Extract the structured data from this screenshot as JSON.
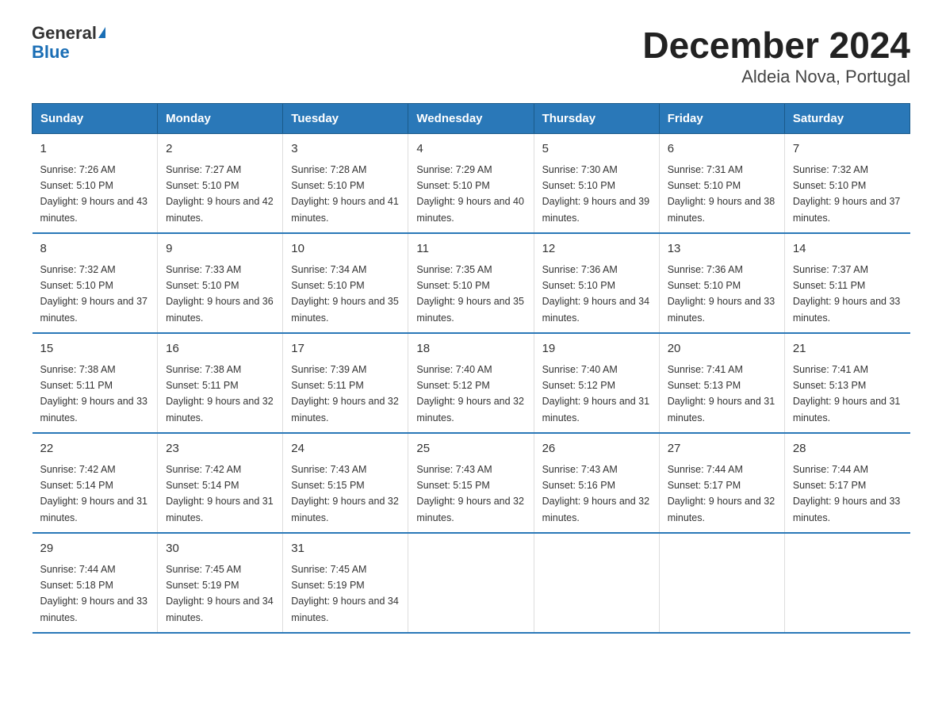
{
  "header": {
    "logo_general": "General",
    "logo_blue": "Blue",
    "title": "December 2024",
    "subtitle": "Aldeia Nova, Portugal"
  },
  "days_of_week": [
    "Sunday",
    "Monday",
    "Tuesday",
    "Wednesday",
    "Thursday",
    "Friday",
    "Saturday"
  ],
  "weeks": [
    [
      {
        "num": "1",
        "sunrise": "7:26 AM",
        "sunset": "5:10 PM",
        "daylight": "9 hours and 43 minutes."
      },
      {
        "num": "2",
        "sunrise": "7:27 AM",
        "sunset": "5:10 PM",
        "daylight": "9 hours and 42 minutes."
      },
      {
        "num": "3",
        "sunrise": "7:28 AM",
        "sunset": "5:10 PM",
        "daylight": "9 hours and 41 minutes."
      },
      {
        "num": "4",
        "sunrise": "7:29 AM",
        "sunset": "5:10 PM",
        "daylight": "9 hours and 40 minutes."
      },
      {
        "num": "5",
        "sunrise": "7:30 AM",
        "sunset": "5:10 PM",
        "daylight": "9 hours and 39 minutes."
      },
      {
        "num": "6",
        "sunrise": "7:31 AM",
        "sunset": "5:10 PM",
        "daylight": "9 hours and 38 minutes."
      },
      {
        "num": "7",
        "sunrise": "7:32 AM",
        "sunset": "5:10 PM",
        "daylight": "9 hours and 37 minutes."
      }
    ],
    [
      {
        "num": "8",
        "sunrise": "7:32 AM",
        "sunset": "5:10 PM",
        "daylight": "9 hours and 37 minutes."
      },
      {
        "num": "9",
        "sunrise": "7:33 AM",
        "sunset": "5:10 PM",
        "daylight": "9 hours and 36 minutes."
      },
      {
        "num": "10",
        "sunrise": "7:34 AM",
        "sunset": "5:10 PM",
        "daylight": "9 hours and 35 minutes."
      },
      {
        "num": "11",
        "sunrise": "7:35 AM",
        "sunset": "5:10 PM",
        "daylight": "9 hours and 35 minutes."
      },
      {
        "num": "12",
        "sunrise": "7:36 AM",
        "sunset": "5:10 PM",
        "daylight": "9 hours and 34 minutes."
      },
      {
        "num": "13",
        "sunrise": "7:36 AM",
        "sunset": "5:10 PM",
        "daylight": "9 hours and 33 minutes."
      },
      {
        "num": "14",
        "sunrise": "7:37 AM",
        "sunset": "5:11 PM",
        "daylight": "9 hours and 33 minutes."
      }
    ],
    [
      {
        "num": "15",
        "sunrise": "7:38 AM",
        "sunset": "5:11 PM",
        "daylight": "9 hours and 33 minutes."
      },
      {
        "num": "16",
        "sunrise": "7:38 AM",
        "sunset": "5:11 PM",
        "daylight": "9 hours and 32 minutes."
      },
      {
        "num": "17",
        "sunrise": "7:39 AM",
        "sunset": "5:11 PM",
        "daylight": "9 hours and 32 minutes."
      },
      {
        "num": "18",
        "sunrise": "7:40 AM",
        "sunset": "5:12 PM",
        "daylight": "9 hours and 32 minutes."
      },
      {
        "num": "19",
        "sunrise": "7:40 AM",
        "sunset": "5:12 PM",
        "daylight": "9 hours and 31 minutes."
      },
      {
        "num": "20",
        "sunrise": "7:41 AM",
        "sunset": "5:13 PM",
        "daylight": "9 hours and 31 minutes."
      },
      {
        "num": "21",
        "sunrise": "7:41 AM",
        "sunset": "5:13 PM",
        "daylight": "9 hours and 31 minutes."
      }
    ],
    [
      {
        "num": "22",
        "sunrise": "7:42 AM",
        "sunset": "5:14 PM",
        "daylight": "9 hours and 31 minutes."
      },
      {
        "num": "23",
        "sunrise": "7:42 AM",
        "sunset": "5:14 PM",
        "daylight": "9 hours and 31 minutes."
      },
      {
        "num": "24",
        "sunrise": "7:43 AM",
        "sunset": "5:15 PM",
        "daylight": "9 hours and 32 minutes."
      },
      {
        "num": "25",
        "sunrise": "7:43 AM",
        "sunset": "5:15 PM",
        "daylight": "9 hours and 32 minutes."
      },
      {
        "num": "26",
        "sunrise": "7:43 AM",
        "sunset": "5:16 PM",
        "daylight": "9 hours and 32 minutes."
      },
      {
        "num": "27",
        "sunrise": "7:44 AM",
        "sunset": "5:17 PM",
        "daylight": "9 hours and 32 minutes."
      },
      {
        "num": "28",
        "sunrise": "7:44 AM",
        "sunset": "5:17 PM",
        "daylight": "9 hours and 33 minutes."
      }
    ],
    [
      {
        "num": "29",
        "sunrise": "7:44 AM",
        "sunset": "5:18 PM",
        "daylight": "9 hours and 33 minutes."
      },
      {
        "num": "30",
        "sunrise": "7:45 AM",
        "sunset": "5:19 PM",
        "daylight": "9 hours and 34 minutes."
      },
      {
        "num": "31",
        "sunrise": "7:45 AM",
        "sunset": "5:19 PM",
        "daylight": "9 hours and 34 minutes."
      },
      null,
      null,
      null,
      null
    ]
  ]
}
